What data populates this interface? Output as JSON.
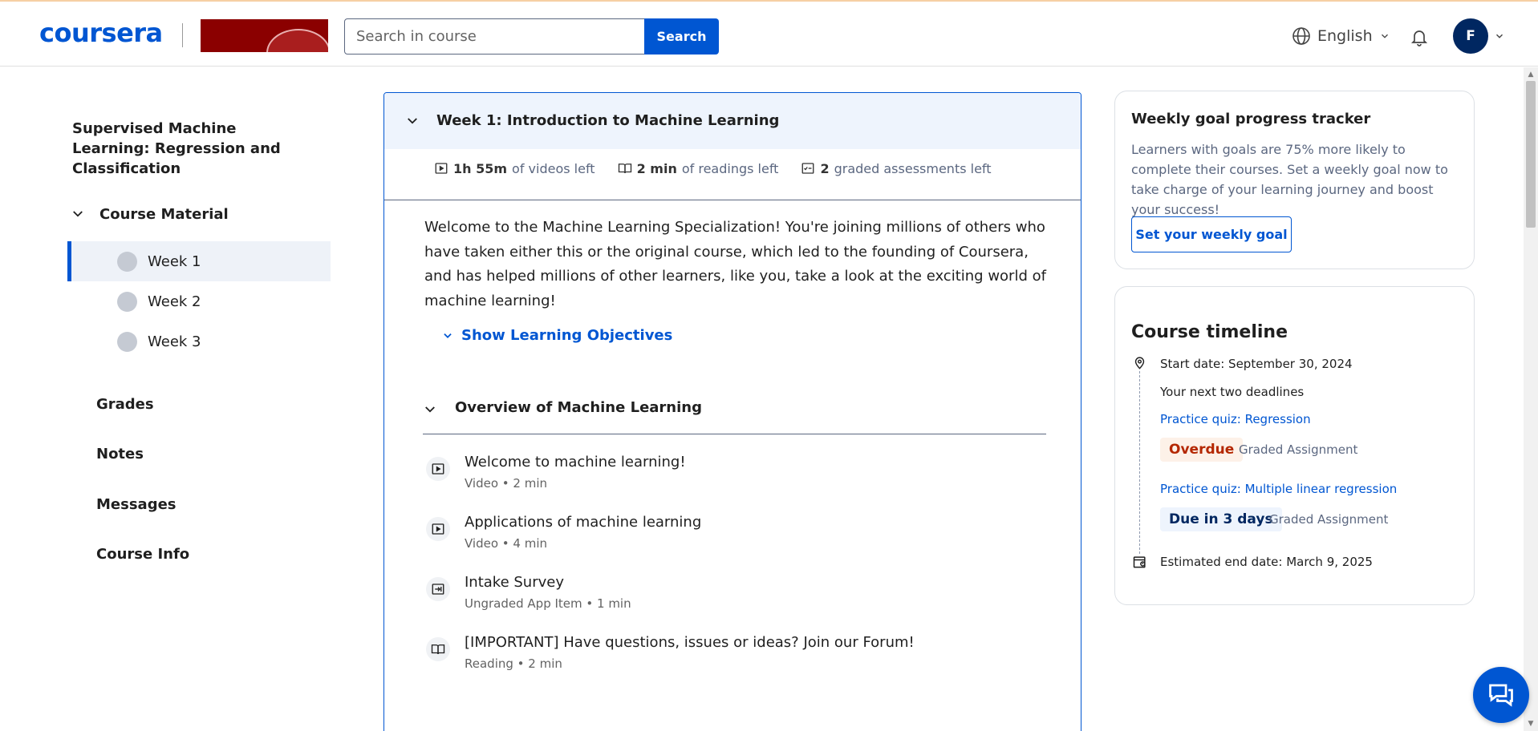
{
  "header": {
    "logo_text": "coursera",
    "search_placeholder": "Search in course",
    "search_button": "Search",
    "language": "English",
    "avatar_initial": "F"
  },
  "sidebar": {
    "course_title": "Supervised Machine Learning: Regression and Classification",
    "course_material_label": "Course Material",
    "weeks": [
      {
        "label": "Week 1",
        "active": true
      },
      {
        "label": "Week 2",
        "active": false
      },
      {
        "label": "Week 3",
        "active": false
      }
    ],
    "links": [
      "Grades",
      "Notes",
      "Messages",
      "Course Info"
    ]
  },
  "main": {
    "week_title": "Week 1: Introduction to Machine Learning",
    "stats": {
      "videos_value": "1h 55m",
      "videos_label": "of videos left",
      "readings_value": "2 min",
      "readings_label": "of readings left",
      "assessments_value": "2",
      "assessments_label": "graded assessments left"
    },
    "welcome_text": "Welcome to the Machine Learning Specialization! You're joining millions of others who have taken either this or the original course, which led to the founding of Coursera, and has helped millions of other learners, like you, take a look at the exciting world of machine learning!",
    "objectives_link": "Show Learning Objectives",
    "section_title": "Overview of Machine Learning",
    "items": [
      {
        "name": "Welcome to machine learning!",
        "meta": "Video • 2 min",
        "icon": "video-icon"
      },
      {
        "name": "Applications of machine learning",
        "meta": "Video • 4 min",
        "icon": "video-icon"
      },
      {
        "name": "Intake Survey",
        "meta": "Ungraded App Item • 1 min",
        "icon": "app-item-icon"
      },
      {
        "name": "[IMPORTANT] Have questions, issues or ideas? Join our Forum!",
        "meta": "Reading • 2 min",
        "icon": "reading-icon"
      }
    ]
  },
  "goal": {
    "title": "Weekly goal progress tracker",
    "text": "Learners with goals are 75% more likely to complete their courses. Set a weekly goal now to take charge of your learning journey and boost your success!",
    "button": "Set your weekly goal"
  },
  "timeline": {
    "title": "Course timeline",
    "start_date": "Start date: September 30, 2024",
    "next_deadlines": "Your next two deadlines",
    "deadlines": [
      {
        "link": "Practice quiz: Regression",
        "badge": "Overdue",
        "type": "Graded Assignment"
      },
      {
        "link": "Practice quiz: Multiple linear regression",
        "badge": "Due in 3 days",
        "type": "Graded Assignment"
      }
    ],
    "end_date": "Estimated end date: March 9, 2025"
  },
  "colors": {
    "brand": "#0056d2",
    "overdue": "#b42700",
    "avatar": "#002761"
  }
}
